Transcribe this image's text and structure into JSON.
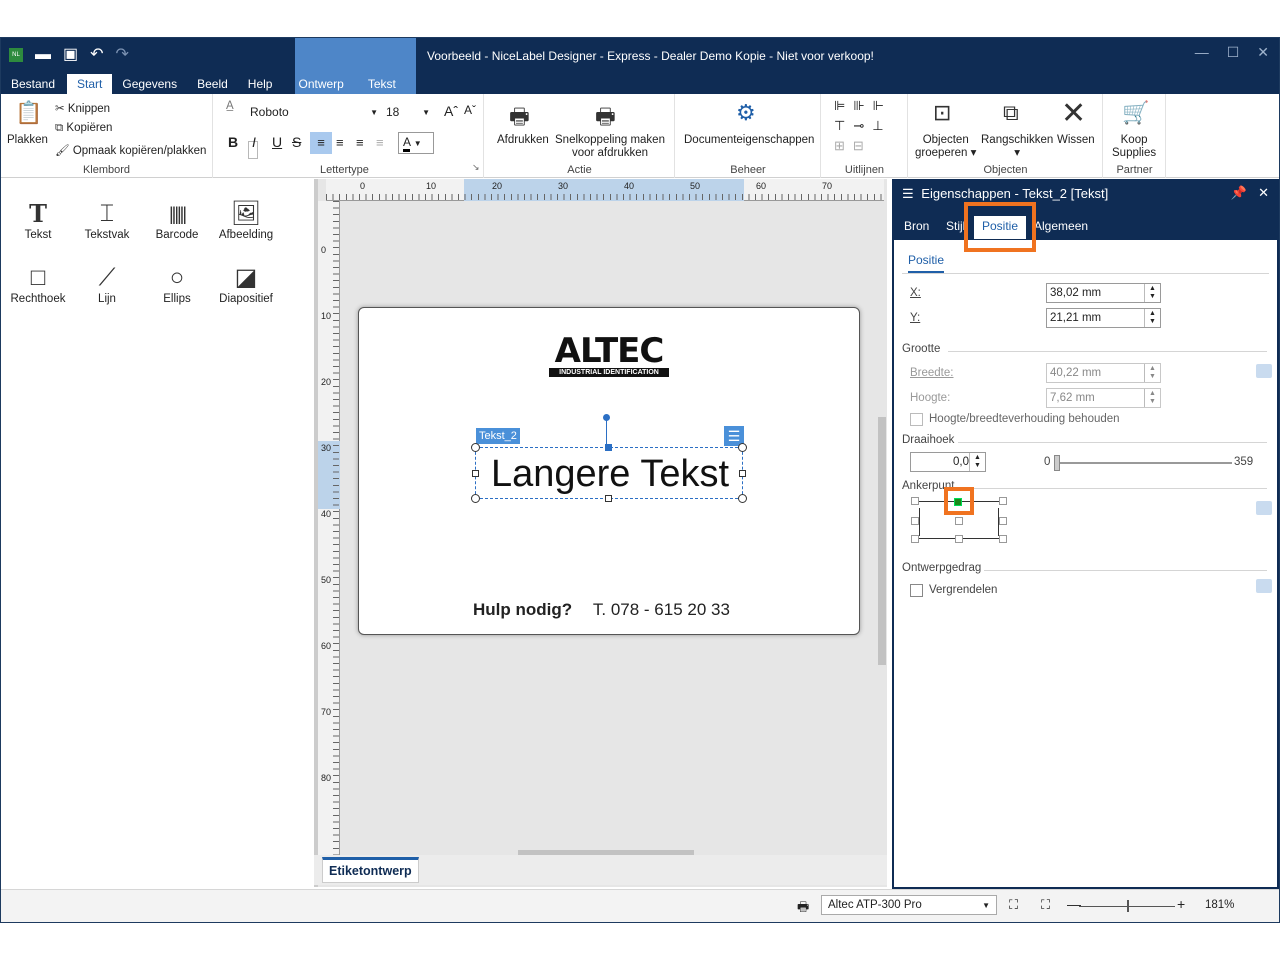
{
  "window": {
    "title": "Voorbeeld - NiceLabel Designer - Express - Dealer Demo Kopie - Niet voor verkoop!",
    "menu": [
      "Bestand",
      "Start",
      "Gegevens",
      "Beeld",
      "Help",
      "Ontwerp",
      "Tekst"
    ]
  },
  "ribbon": {
    "clipboard": {
      "paste": "Plakken",
      "cut": "Knippen",
      "copy": "Kopiëren",
      "format": "Opmaak kopiëren/plakken",
      "label": "Klembord"
    },
    "font": {
      "family": "Roboto",
      "size": "18",
      "label": "Lettertype",
      "bold": "B",
      "italic": "I",
      "underline": "U",
      "strike": "S",
      "color_letter": "A"
    },
    "action": {
      "print": "Afdrukken",
      "shortcut_line1": "Snelkoppeling maken",
      "shortcut_line2": "voor afdrukken",
      "label": "Actie"
    },
    "manage": {
      "docprops": "Documenteigenschappen",
      "label": "Beheer"
    },
    "align": {
      "label": "Uitlijnen"
    },
    "objects": {
      "group_line1": "Objecten",
      "group_line2": "groeperen",
      "arrange": "Rangschikken",
      "delete": "Wissen",
      "label": "Objecten"
    },
    "partner": {
      "buy_line1": "Koop",
      "buy_line2": "Supplies",
      "label": "Partner"
    }
  },
  "toolbox": {
    "tools": [
      {
        "label": "Tekst"
      },
      {
        "label": "Tekstvak"
      },
      {
        "label": "Barcode"
      },
      {
        "label": "Afbeelding"
      },
      {
        "label": "Rechthoek"
      },
      {
        "label": "Lijn"
      },
      {
        "label": "Ellips"
      },
      {
        "label": "Diapositief"
      }
    ]
  },
  "canvas": {
    "ruler_h": [
      "0",
      "10",
      "20",
      "30",
      "40",
      "50",
      "60",
      "70"
    ],
    "ruler_v": [
      "0",
      "10",
      "20",
      "30",
      "40",
      "50",
      "60",
      "70",
      "80"
    ],
    "label": {
      "logo": "ALTEC",
      "logo_sub": "INDUSTRIAL IDENTIFICATION",
      "object_tag": "Tekst_2",
      "main_text": "Langere Tekst",
      "help_bold": "Hulp nodig?",
      "help_phone": "T. 078 - 615 20 33"
    },
    "tab": "Etiketontwerp"
  },
  "properties": {
    "title": "Eigenschappen - Tekst_2 [Tekst]",
    "tabs": [
      "Bron",
      "Stijl",
      "Positie",
      "Algemeen"
    ],
    "subtab": "Positie",
    "x_label": "X:",
    "x_value": "38,02 mm",
    "y_label": "Y:",
    "y_value": "21,21 mm",
    "size_section": "Grootte",
    "width_label": "Breedte:",
    "width_value": "40,22 mm",
    "height_label": "Hoogte:",
    "height_value": "7,62 mm",
    "keep_ratio": "Hoogte/breedteverhouding behouden",
    "rotation_section": "Draaihoek",
    "rotation_value": "0,0",
    "slider_min": "0",
    "slider_max": "359",
    "anchor_section": "Ankerpunt",
    "design_section": "Ontwerpgedrag",
    "lock": "Vergrendelen"
  },
  "status": {
    "printer": "Altec ATP-300 Pro",
    "zoom": "181%"
  },
  "colors": {
    "titlebar": "#0f2c54",
    "accent": "#1f5fa8",
    "highlight": "#f07320"
  }
}
